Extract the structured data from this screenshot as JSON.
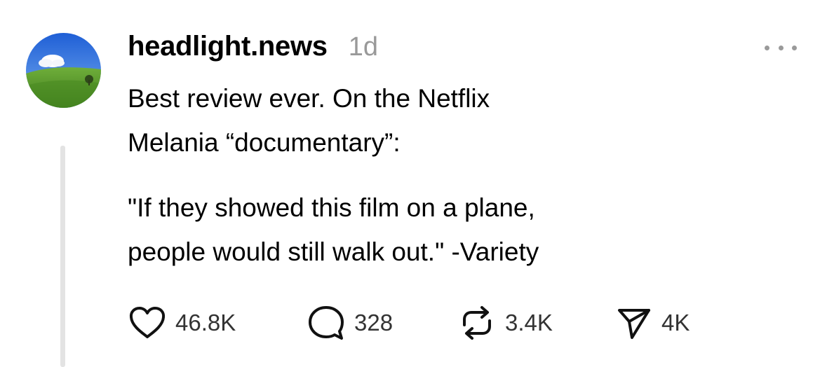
{
  "post": {
    "username": "headlight.news",
    "timestamp": "1d",
    "avatar_icon": "landscape-avatar-icon",
    "more_icon": "more-options-icon",
    "text_lines": [
      "Best review ever. On the Netflix",
      "Melania “documentary”:",
      "\"If they showed this film on a plane,",
      "people would still walk out.\" -Variety"
    ],
    "actions": {
      "like": {
        "icon": "heart-icon",
        "count": "46.8K"
      },
      "reply": {
        "icon": "comment-bubble-icon",
        "count": "328"
      },
      "repost": {
        "icon": "repost-arrows-icon",
        "count": "3.4K"
      },
      "share": {
        "icon": "send-paper-plane-icon",
        "count": "4K"
      }
    }
  },
  "colors": {
    "text": "#000000",
    "secondary_text": "#999999",
    "count_text": "#333333",
    "thread_line": "#e3e3e3",
    "background": "#ffffff"
  }
}
